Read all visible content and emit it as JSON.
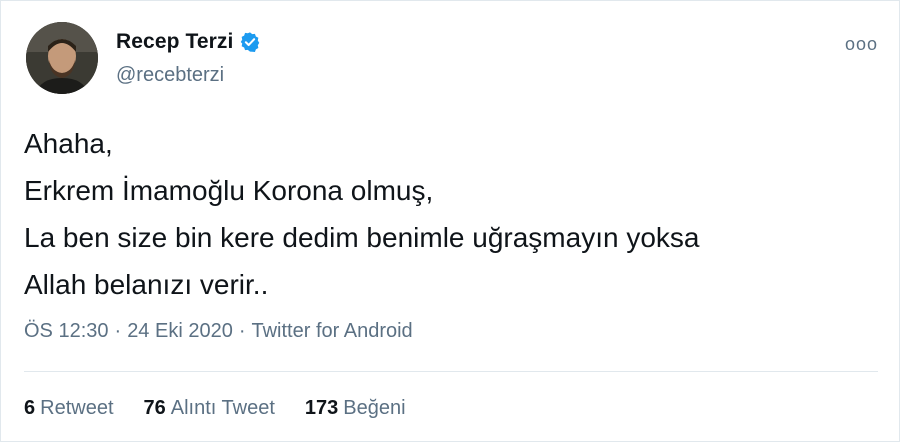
{
  "author": {
    "name": "Recep Terzi",
    "handle": "@recebterzi",
    "verified": true
  },
  "tweet": {
    "lines": [
      "Ahaha,",
      "Erkrem İmamoğlu Korona olmuş,",
      "La ben size bin kere dedim benimle uğraşmayın yoksa",
      "Allah belanızı verir.."
    ],
    "time": "ÖS 12:30",
    "separator": "·",
    "date": "24 Eki 2020",
    "source": "Twitter for Android"
  },
  "more_icon": "ooo",
  "stats": {
    "retweets": {
      "count": "6",
      "label": "Retweet"
    },
    "quotes": {
      "count": "76",
      "label": "Alıntı Tweet"
    },
    "likes": {
      "count": "173",
      "label": "Beğeni"
    }
  },
  "colors": {
    "text": "#0f1419",
    "secondary": "#5b7083",
    "verified": "#1d9bf0",
    "border": "#e1e8ed"
  }
}
